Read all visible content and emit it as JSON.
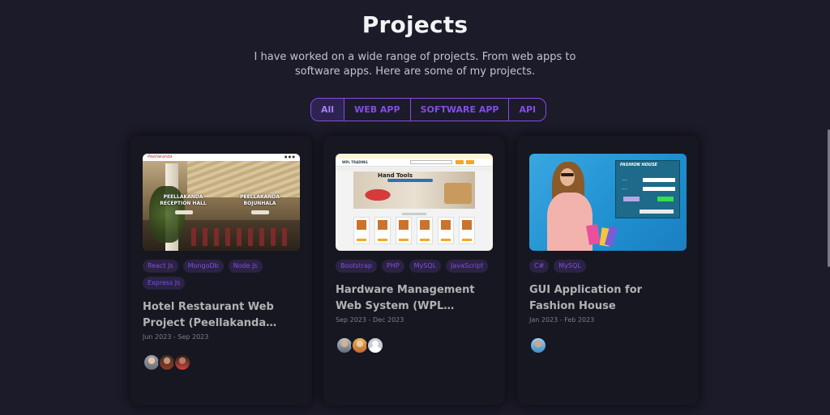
{
  "section": {
    "title": "Projects",
    "description": "I have worked on a wide range of projects. From web apps to software apps. Here are some of my projects."
  },
  "tabs": [
    {
      "label": "All",
      "active": true
    },
    {
      "label": "WEB APP",
      "active": false
    },
    {
      "label": "SOFTWARE APP",
      "active": false
    },
    {
      "label": "API",
      "active": false
    }
  ],
  "colors": {
    "accent": "#854ce6",
    "background": "#1c1b29",
    "card": "#171721",
    "title_text": "#b1b2b3"
  },
  "projects": [
    {
      "title": "Hotel Restaurant Web Project (Peellakanda Restaurant)",
      "date": "Jun 2023 - Sep 2023",
      "tags": [
        "React Js",
        "MongoDb",
        "Node Js",
        "Express Js"
      ],
      "image": {
        "logo": "Peellakanda",
        "label_left": "PEELLAKANDA RECEPTION HALL",
        "label_right": "PEELLAKANDA BOJUNHALA"
      },
      "members": 3
    },
    {
      "title": "Hardware Management Web System (WPL Trading)",
      "date": "Sep 2023 - Dec 2023",
      "tags": [
        "Bootstrap",
        "PHP",
        "MySQL",
        "JavaScript"
      ],
      "image": {
        "brand": "WPL TRADING",
        "banner_title": "Hand Tools"
      },
      "members": 3
    },
    {
      "title": "GUI Application for Fashion House",
      "date": "Jan 2023 - Feb 2023",
      "tags": [
        "C#",
        "MySQL"
      ],
      "image": {
        "window_title": "FASHION HOUSE"
      },
      "members": 1
    }
  ]
}
